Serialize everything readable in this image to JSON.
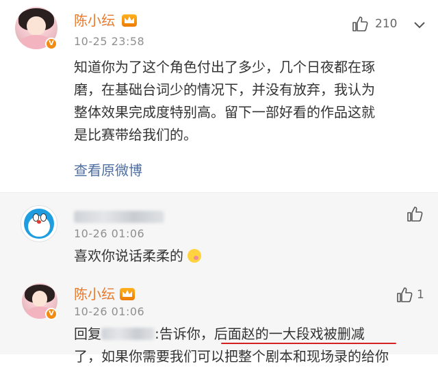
{
  "main_comment": {
    "username": "陈小纭",
    "timestamp": "10-25 23:58",
    "like_count": "210",
    "text_lines": [
      "知道你为了这个角色付出了多少，几个日夜都在琢",
      "磨，在基础台词少的情况下，并没有放弃，我认为",
      "整体效果完成度特别高。留下一部好看的作品这就",
      "是比赛带给我们的。"
    ],
    "view_original": "查看原微博",
    "verified_badge": "V"
  },
  "replies": [
    {
      "username": "",
      "timestamp": "10-26 01:06",
      "text": "喜欢你说话柔柔的",
      "emoji": "blush-emoji"
    },
    {
      "username": "陈小纭",
      "timestamp": "10-26 01:06",
      "like_count": "1",
      "reply_prefix": "回复",
      "reply_mid": ":告诉你，",
      "reply_underlined": "后面赵的一大段戏被删减",
      "reply_cutoff": "了，如果你需要我们可以把整个剧本和现场录的给你"
    }
  ],
  "icons": {
    "like": "thumbs-up-icon",
    "more": "chevron-down-icon",
    "crown": "crown-icon"
  },
  "colors": {
    "username": "#e8782b",
    "link": "#4e6ea0",
    "badge": "#f28b14",
    "underline": "#d62020",
    "reply_bg": "#f6f6f6"
  }
}
